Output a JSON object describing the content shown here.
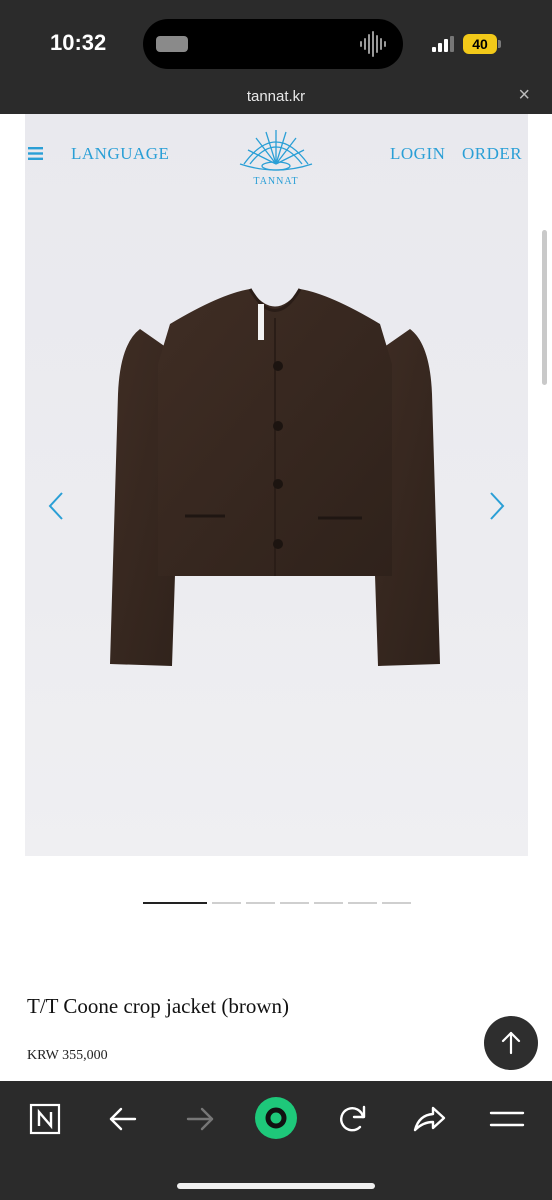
{
  "status_bar": {
    "time": "10:32",
    "battery": "40"
  },
  "url_bar": {
    "domain": "tannat.kr",
    "close_glyph": "×"
  },
  "site_nav": {
    "language": "LANGUAGE",
    "brand": "TANNAT",
    "login": "LOGIN",
    "order": "ORDER"
  },
  "carousel": {
    "total_images": 7,
    "current_index": 1
  },
  "product": {
    "name": "T/T Coone crop jacket (brown)",
    "price": "KRW 355,000"
  },
  "colors": {
    "accent": "#2a9fd6",
    "toolbar_green": "#1ec87a",
    "jacket_brown": "#3b2a22"
  },
  "toolbar": {
    "icons": [
      "naver-n-icon",
      "back-arrow-icon",
      "forward-arrow-icon",
      "green-dot-icon",
      "reload-icon",
      "share-icon",
      "menu-icon"
    ]
  }
}
